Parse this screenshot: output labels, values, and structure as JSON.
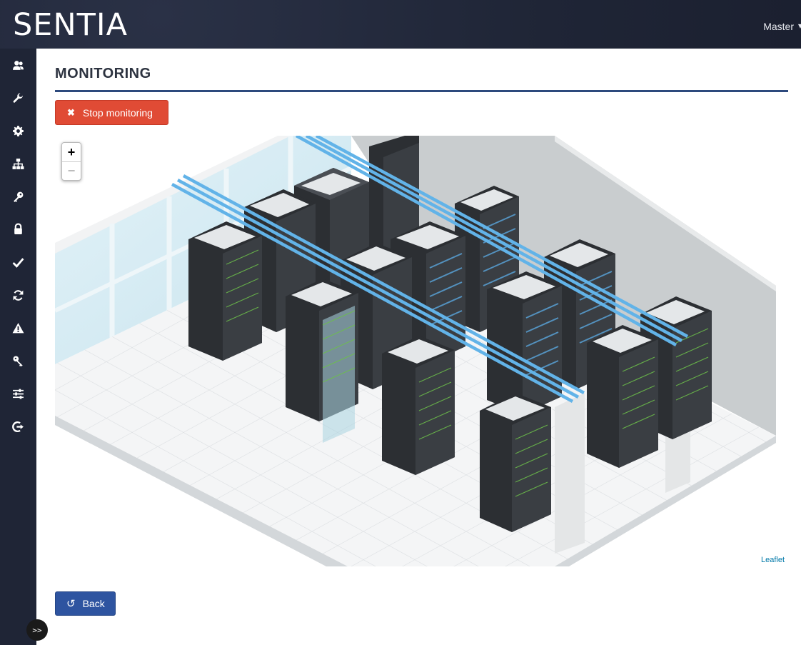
{
  "header": {
    "brand": "SENTIA",
    "user": "Master",
    "user_caret_icon": "caret-down-icon"
  },
  "sidebar": {
    "items": [
      {
        "icon": "users-icon"
      },
      {
        "icon": "wrench-icon"
      },
      {
        "icon": "gear-icon"
      },
      {
        "icon": "sitemap-icon"
      },
      {
        "icon": "key-icon"
      },
      {
        "icon": "lock-icon"
      },
      {
        "icon": "check-icon"
      },
      {
        "icon": "refresh-icon"
      },
      {
        "icon": "warning-icon"
      },
      {
        "icon": "keys-icon"
      },
      {
        "icon": "sliders-icon"
      },
      {
        "icon": "sign-out-icon"
      }
    ],
    "expander_label": ">>"
  },
  "main": {
    "title": "MONITORING",
    "stop_button": "Stop monitoring",
    "back_button": "Back"
  },
  "map": {
    "zoom_in": "+",
    "zoom_out": "−",
    "attribution": "Leaflet"
  },
  "colors": {
    "topbar": "#1f2536",
    "accent": "#2d4a7d",
    "danger": "#e04b35",
    "primary": "#2e54a0"
  }
}
